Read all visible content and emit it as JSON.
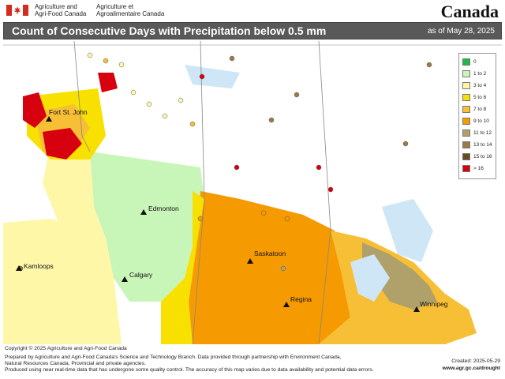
{
  "header": {
    "agency_en_1": "Agriculture and",
    "agency_en_2": "Agri-Food Canada",
    "agency_fr_1": "Agriculture et",
    "agency_fr_2": "Agroalimentaire Canada",
    "wordmark": "Canada"
  },
  "title": "Count of Consecutive Days with Precipitation below 0.5 mm",
  "date": "as of May 28, 2025",
  "legend": [
    {
      "label": "0",
      "color": "#1db84a"
    },
    {
      "label": "1 to 2",
      "color": "#c8f5b8"
    },
    {
      "label": "3 to 4",
      "color": "#fff7a8"
    },
    {
      "label": "5 to 6",
      "color": "#f8e000"
    },
    {
      "label": "7 to 8",
      "color": "#f7bf36"
    },
    {
      "label": "9 to 10",
      "color": "#f59a00"
    },
    {
      "label": "11 to 12",
      "color": "#b0a06a"
    },
    {
      "label": "13 to 14",
      "color": "#9a7a46"
    },
    {
      "label": "15 to 16",
      "color": "#6b4a20"
    },
    {
      "label": "> 16",
      "color": "#d6000f"
    }
  ],
  "cities": [
    {
      "name": "Fort St. John"
    },
    {
      "name": "Edmonton"
    },
    {
      "name": "Kamloops"
    },
    {
      "name": "Calgary"
    },
    {
      "name": "Saskatoon"
    },
    {
      "name": "Regina"
    },
    {
      "name": "Winnipeg"
    }
  ],
  "footer": {
    "copyright": "© Copyright © 2025 Agriculture and Agri-Food Canada",
    "note1": "Prepared by Agriculture and Agri-Food Canada's Science and Technology Branch. Data provided through partnership with Environment Canada,",
    "note2": "Natural Resources Canada, Provincial and private agencies.",
    "note3": "Produced using near real-time data that has undergone some quality control. The accuracy of this map varies due to data availability and potential data errors.",
    "created": "Created: 2025-05-29",
    "website": "www.agr.gc.ca/drought"
  }
}
